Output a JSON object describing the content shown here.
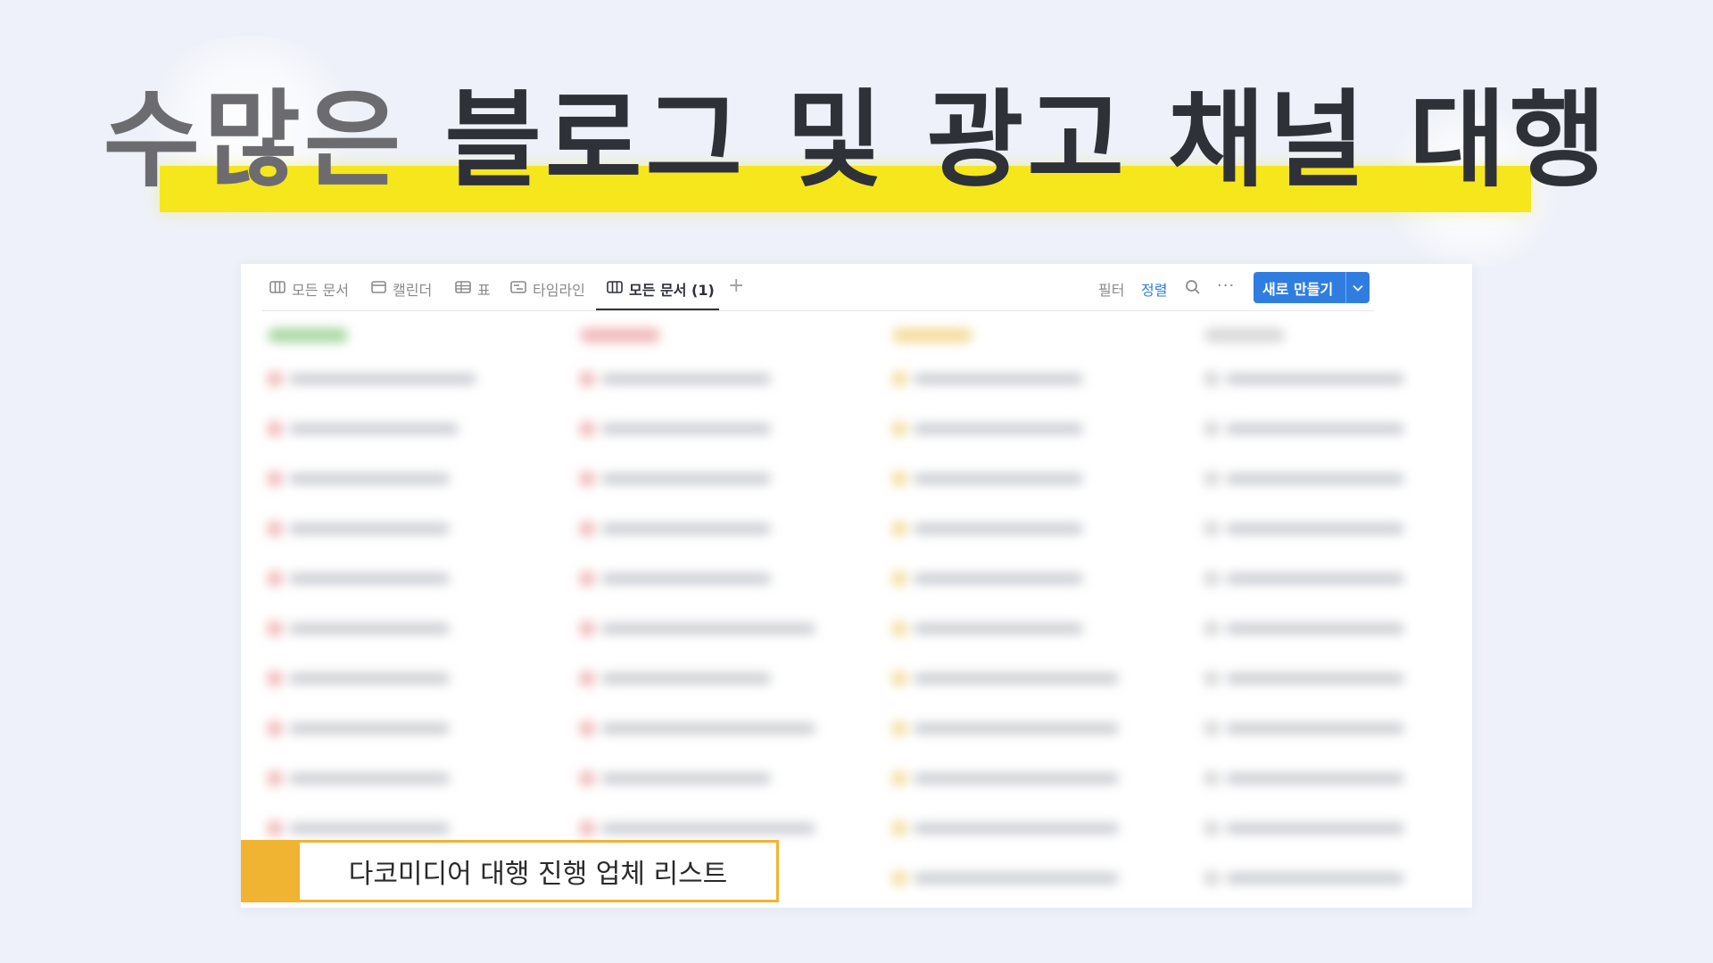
{
  "headline": {
    "word1": "수많은",
    "rest": " 블로그 및 광고 채널 대행",
    "highlight_color": "#f6e61c"
  },
  "toolbar": {
    "tabs": [
      {
        "label": "모든 문서",
        "icon": "board-icon"
      },
      {
        "label": "캘린더",
        "icon": "calendar-icon"
      },
      {
        "label": "표",
        "icon": "table-icon"
      },
      {
        "label": "타임라인",
        "icon": "timeline-icon"
      },
      {
        "label": "모든 문서 (1)",
        "icon": "board-icon",
        "active": true
      }
    ],
    "add_tab": "+",
    "filter": "필터",
    "sort": "정렬",
    "search_icon": "search-icon",
    "more": "···",
    "new_button": "새로 만들기",
    "accent": "#2f7de1"
  },
  "caption": {
    "text": "다코미디어 대행 진행 업체 리스트",
    "accent": "#f0b432"
  }
}
